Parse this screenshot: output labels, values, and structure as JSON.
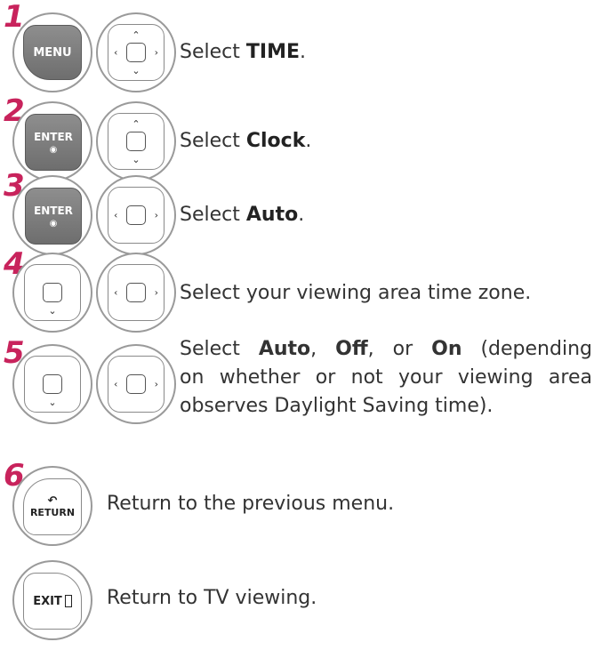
{
  "steps": [
    {
      "number": "1",
      "text_pre": "Select ",
      "text_bold": "TIME",
      "text_post": ".",
      "key": "MENU"
    },
    {
      "number": "2",
      "text_pre": "Select ",
      "text_bold": "Clock",
      "text_post": ".",
      "key": "ENTER"
    },
    {
      "number": "3",
      "text_pre": "Select ",
      "text_bold": "Auto",
      "text_post": ".",
      "key": "ENTER"
    },
    {
      "number": "4",
      "text": "Select your viewing area time zone."
    },
    {
      "number": "5",
      "text_a": "Select ",
      "bold_auto": "Auto",
      "sep1": ", ",
      "bold_off": "Off",
      "sep2": ", or ",
      "bold_on": "On",
      "text_b": " (depending",
      "line2": "on whether or not your viewing area",
      "line3": "observes Daylight Saving time)."
    },
    {
      "number": "6",
      "text": "Return to the previous menu.",
      "key": "RETURN"
    },
    {
      "text": "Return to TV viewing.",
      "key": "EXIT"
    }
  ],
  "colors": {
    "step_number": "#c8235c",
    "key_gray": "#7a7a7a",
    "outline": "#9a9a9a"
  },
  "icons": {
    "nav_arrows": "nav-pad-icon",
    "enter_dot": "enter-dot-icon",
    "return_arrow": "return-arrow-icon",
    "exit_door": "exit-door-icon"
  }
}
